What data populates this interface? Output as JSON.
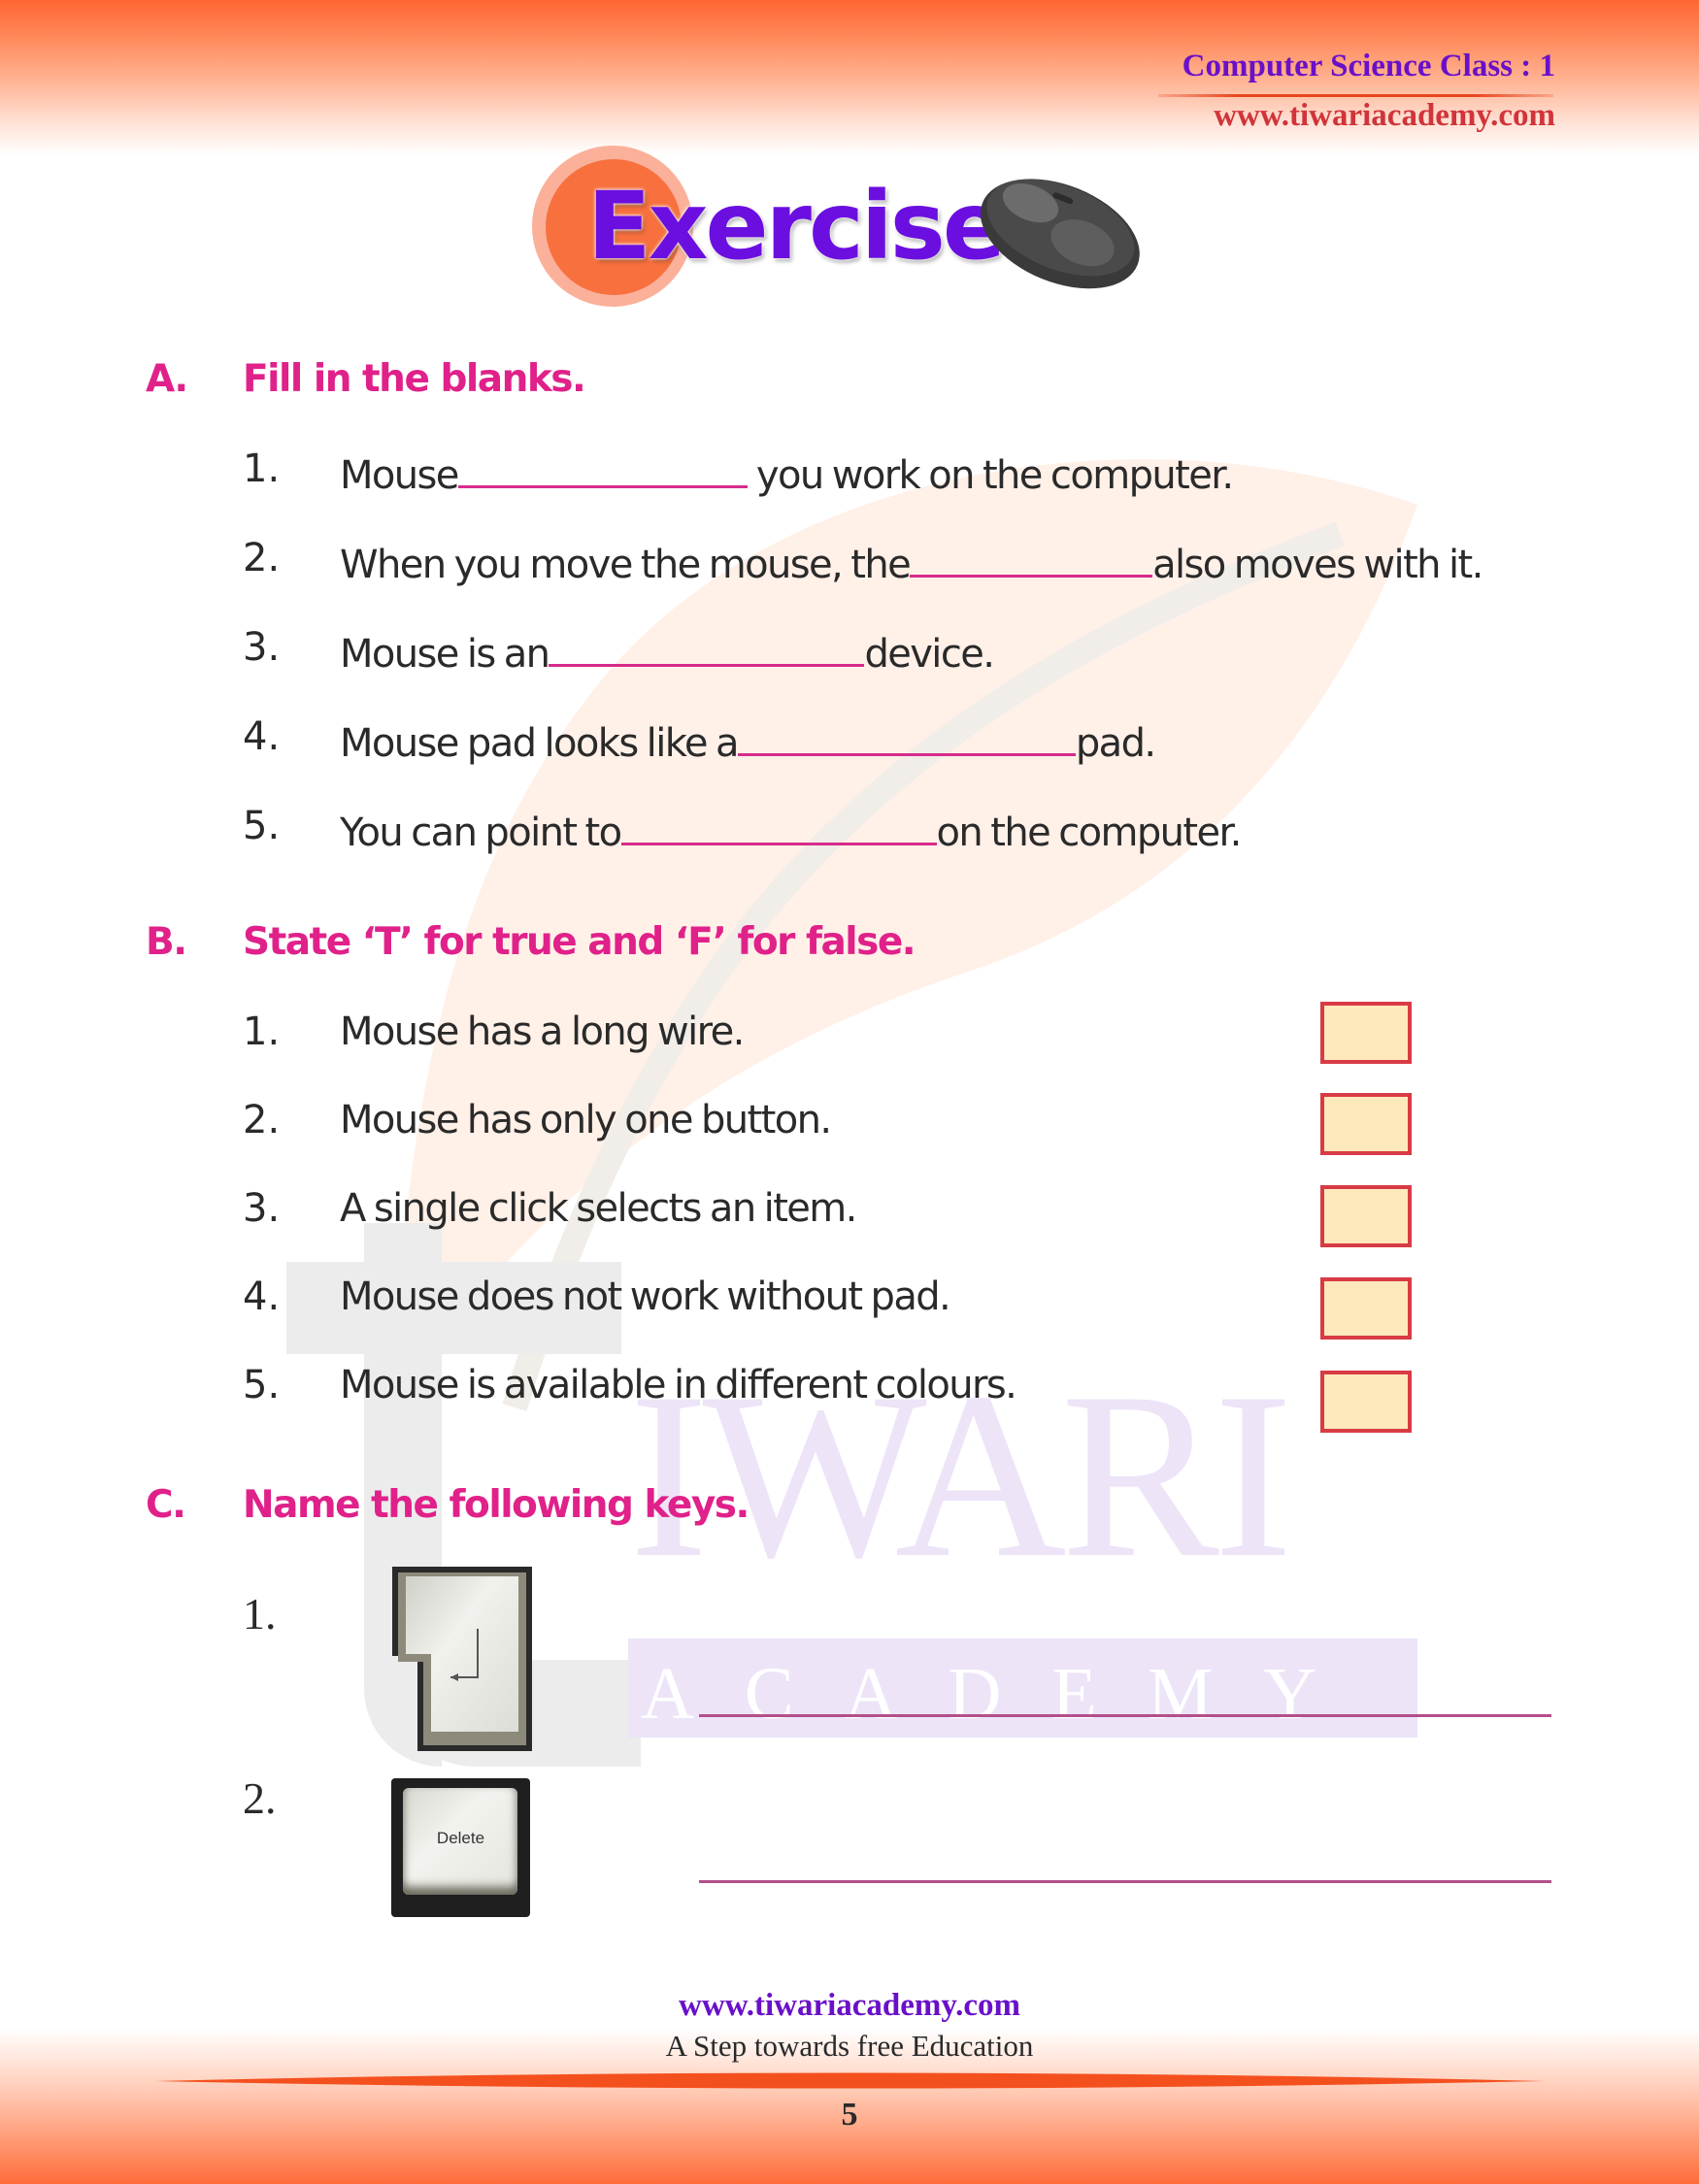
{
  "header": {
    "subject": "Computer Science Class : 1",
    "website": "www.tiwariacademy.com"
  },
  "title": {
    "text": "Exercises",
    "icon": "computer-mouse-icon"
  },
  "watermark": {
    "big": "IWARI",
    "small": "ACADEMY"
  },
  "section_a": {
    "letter": "A.",
    "heading": "Fill in the blanks.",
    "items": [
      {
        "num": "1.",
        "before": "Mouse",
        "after": " you work on the computer."
      },
      {
        "num": "2.",
        "before": "When you move the mouse, the",
        "after": "also moves with it."
      },
      {
        "num": "3.",
        "before": "Mouse is an",
        "after": "device."
      },
      {
        "num": "4.",
        "before": "Mouse pad looks like a",
        "after": "pad."
      },
      {
        "num": "5.",
        "before": "You can point to",
        "after": "on the computer."
      }
    ]
  },
  "section_b": {
    "letter": "B.",
    "heading": "State ‘T’ for true and ‘F’ for false.",
    "items": [
      {
        "num": "1.",
        "text": "Mouse has a long wire.",
        "answer": ""
      },
      {
        "num": "2.",
        "text": "Mouse has only one button.",
        "answer": ""
      },
      {
        "num": "3.",
        "text": "A single click selects an item.",
        "answer": ""
      },
      {
        "num": "4.",
        "text": "Mouse does not work without pad.",
        "answer": ""
      },
      {
        "num": "5.",
        "text": "Mouse is available in different colours.",
        "answer": ""
      }
    ]
  },
  "section_c": {
    "letter": "C.",
    "heading": "Name the following keys.",
    "items": [
      {
        "num": "1.",
        "key_icon": "enter-key-icon",
        "key_label": "↵",
        "answer": ""
      },
      {
        "num": "2.",
        "key_icon": "delete-key-icon",
        "key_label": "Delete",
        "answer": ""
      }
    ]
  },
  "footer": {
    "website": "www.tiwariacademy.com",
    "tagline": "A Step towards free Education",
    "page_number": "5"
  },
  "colors": {
    "heading": "#e0218a",
    "brand_purple": "#6a10c9",
    "brand_red": "#d0343a",
    "accent_orange": "#ff6633",
    "answer_box_fill": "#fde9bb",
    "answer_box_border": "#d83b45"
  }
}
